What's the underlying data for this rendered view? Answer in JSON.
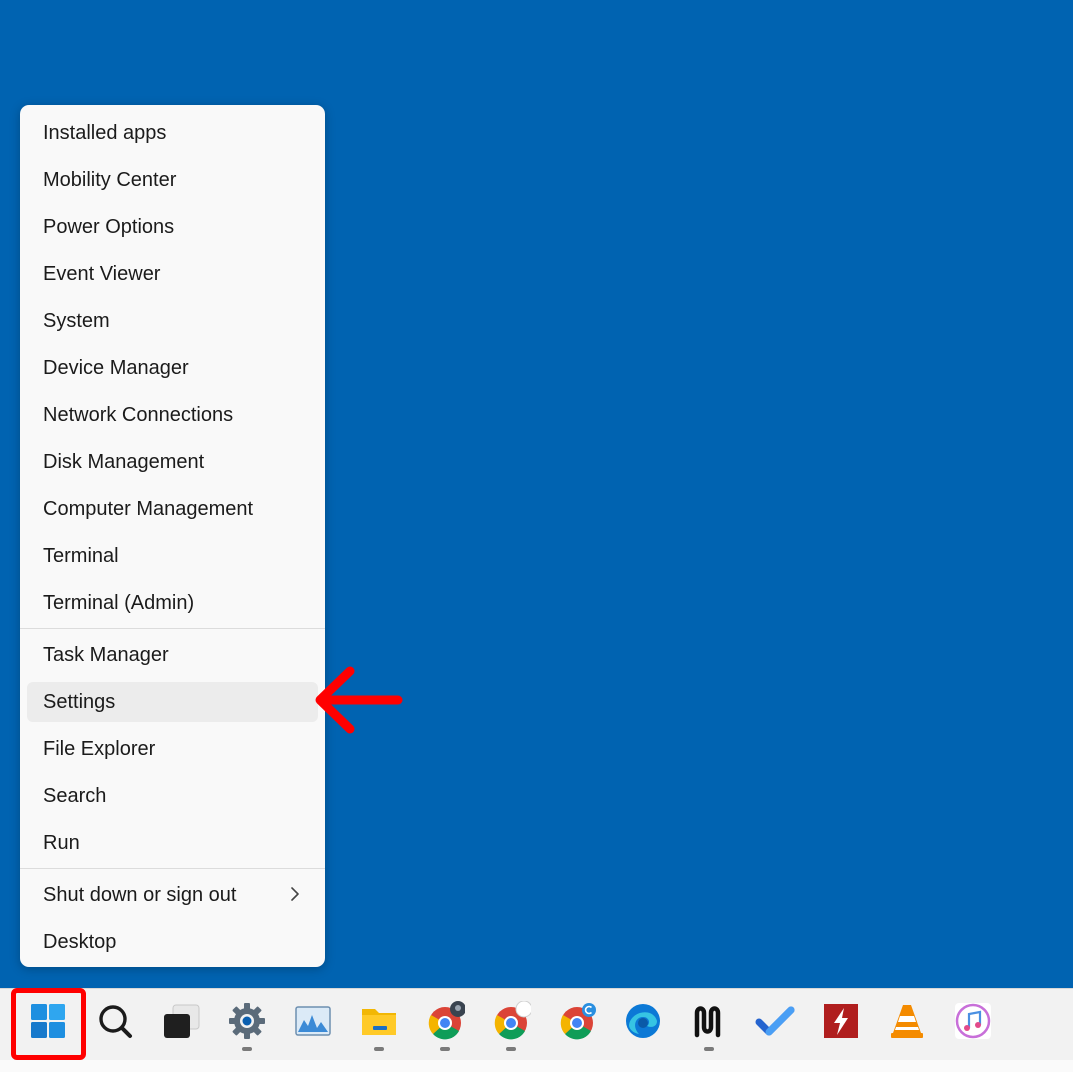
{
  "menu": {
    "items": [
      {
        "label": "Installed apps"
      },
      {
        "label": "Mobility Center"
      },
      {
        "label": "Power Options"
      },
      {
        "label": "Event Viewer"
      },
      {
        "label": "System"
      },
      {
        "label": "Device Manager"
      },
      {
        "label": "Network Connections"
      },
      {
        "label": "Disk Management"
      },
      {
        "label": "Computer Management"
      },
      {
        "label": "Terminal"
      },
      {
        "label": "Terminal (Admin)"
      },
      {
        "label": "Task Manager"
      },
      {
        "label": "Settings",
        "state": "hovered"
      },
      {
        "label": "File Explorer"
      },
      {
        "label": "Search"
      },
      {
        "label": "Run"
      },
      {
        "label": "Shut down or sign out",
        "has_submenu": true
      },
      {
        "label": "Desktop"
      }
    ]
  },
  "annotation": {
    "arrow_target": "Settings",
    "start_highlighted": true,
    "color": "#ff0000"
  },
  "taskbar": {
    "icons": [
      {
        "name": "windows-start-icon"
      },
      {
        "name": "search-icon"
      },
      {
        "name": "task-view-icon"
      },
      {
        "name": "settings-gear-icon",
        "running": true
      },
      {
        "name": "photos-icon"
      },
      {
        "name": "file-explorer-icon",
        "running": true
      },
      {
        "name": "chrome-profile-icon",
        "running": true
      },
      {
        "name": "chrome-icon",
        "running": true
      },
      {
        "name": "chrome-canary-icon"
      },
      {
        "name": "edge-icon"
      },
      {
        "name": "notion-icon",
        "running": true
      },
      {
        "name": "todo-icon"
      },
      {
        "name": "flash-icon"
      },
      {
        "name": "vlc-icon"
      },
      {
        "name": "itunes-icon"
      }
    ]
  },
  "colors": {
    "desktop": "#0063b1",
    "menu_bg": "#f9f9f9",
    "taskbar_bg": "#f2f2f2",
    "highlight": "#ff0000"
  }
}
